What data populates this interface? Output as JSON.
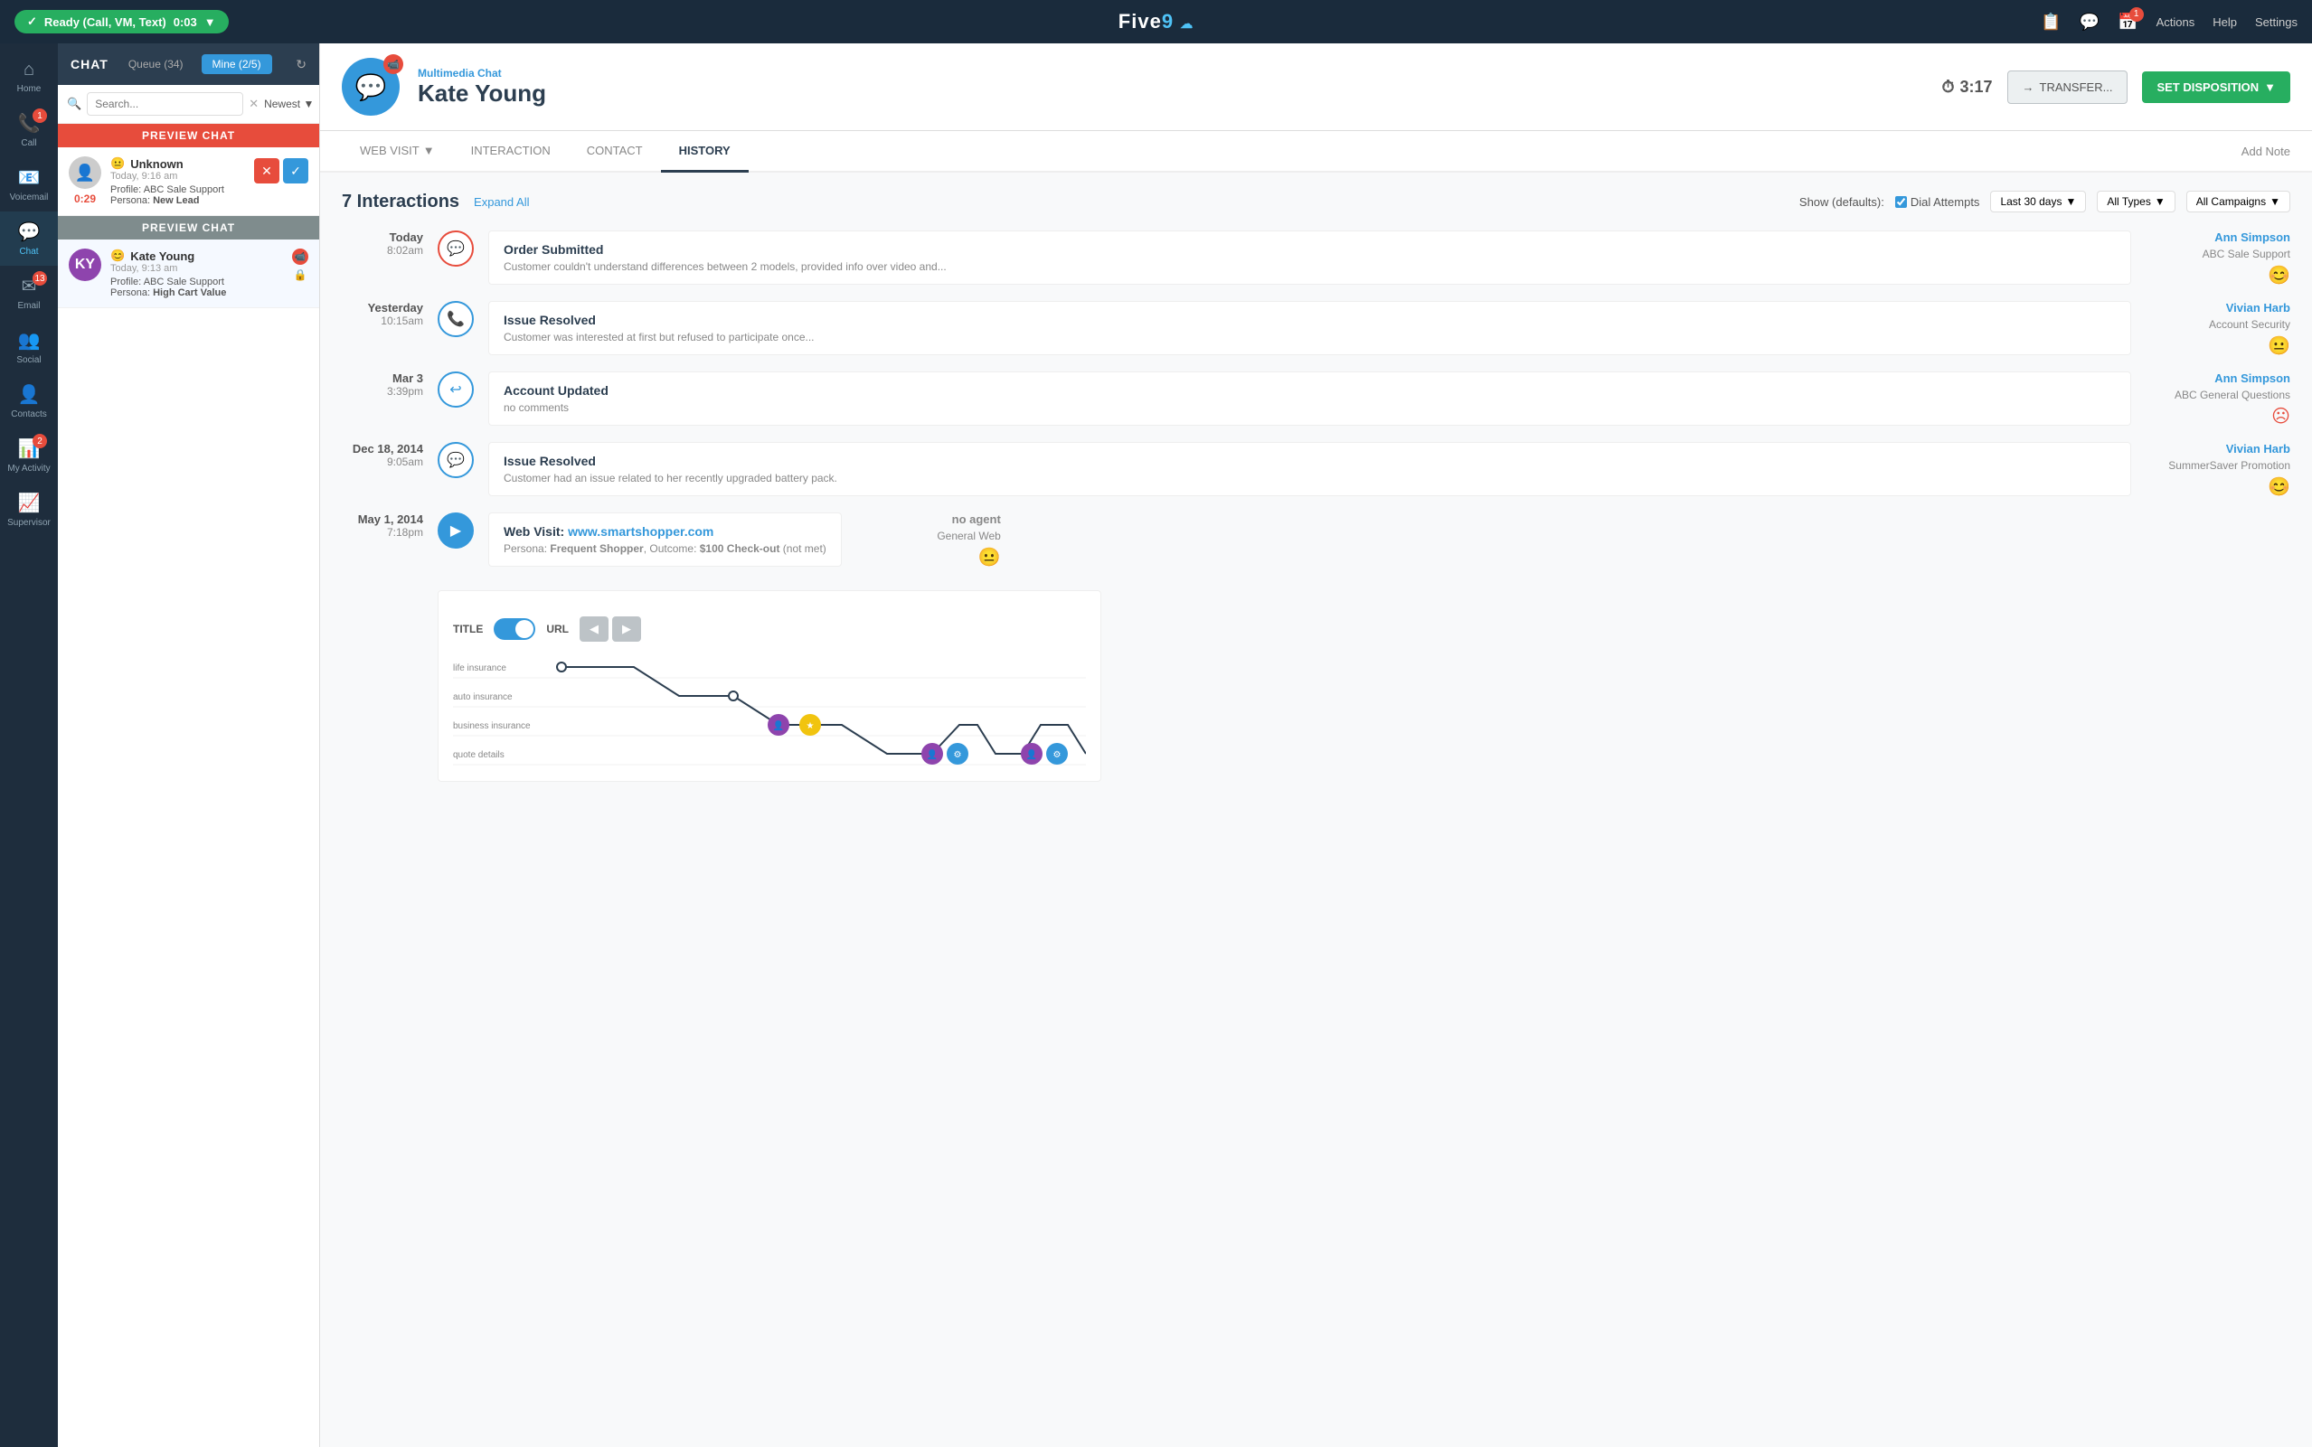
{
  "topbar": {
    "ready_label": "Ready (Call, VM, Text)",
    "timer": "0:03",
    "logo": "Five9",
    "actions_label": "Actions",
    "help_label": "Help",
    "settings_label": "Settings",
    "notification_count": "1"
  },
  "sidebar": {
    "items": [
      {
        "id": "home",
        "label": "Home",
        "icon": "⌂",
        "badge": null
      },
      {
        "id": "call",
        "label": "Call",
        "icon": "📞",
        "badge": "1"
      },
      {
        "id": "voicemail",
        "label": "Voicemail",
        "icon": "📧",
        "badge": null
      },
      {
        "id": "chat",
        "label": "Chat",
        "icon": "💬",
        "badge": null
      },
      {
        "id": "email",
        "label": "Email",
        "icon": "✉",
        "badge": "13"
      },
      {
        "id": "social",
        "label": "Social",
        "icon": "👥",
        "badge": null
      },
      {
        "id": "contacts",
        "label": "Contacts",
        "icon": "👤",
        "badge": null
      },
      {
        "id": "myactivity",
        "label": "My Activity",
        "icon": "📊",
        "badge": "2"
      },
      {
        "id": "supervisor",
        "label": "Supervisor",
        "icon": "📈",
        "badge": null
      }
    ]
  },
  "chat_panel": {
    "title": "CHAT",
    "queue_label": "Queue (34)",
    "mine_label": "Mine (2/5)",
    "search_placeholder": "Search...",
    "sort_label": "Newest",
    "preview_chat_label": "PREVIEW CHAT",
    "items": [
      {
        "name": "Unknown",
        "time": "Today, 9:16 am",
        "profile": "ABC Sale Support",
        "persona": "New Lead",
        "timer": "0:29",
        "has_actions": true,
        "avatar_icon": "👤"
      },
      {
        "name": "Kate Young",
        "time": "Today, 9:13 am",
        "profile": "ABC Sale Support",
        "persona": "High Cart Value",
        "timer": null,
        "has_actions": false,
        "has_lock": true,
        "avatar_url": null
      }
    ]
  },
  "contact_header": {
    "subtitle": "Multimedia Chat",
    "name": "Kate Young",
    "timer": "3:17",
    "transfer_label": "TRANSFER...",
    "disposition_label": "SET DISPOSITION"
  },
  "tabs": {
    "items": [
      {
        "id": "web-visit",
        "label": "WEB VISIT",
        "has_arrow": true
      },
      {
        "id": "interaction",
        "label": "INTERACTION"
      },
      {
        "id": "contact",
        "label": "CONTACT"
      },
      {
        "id": "history",
        "label": "HISTORY",
        "active": true
      }
    ],
    "add_note_label": "Add Note"
  },
  "history": {
    "count": "7 Interactions",
    "expand_all": "Expand All",
    "show_label": "Show (defaults):",
    "dial_attempts_label": "Dial Attempts",
    "last30_label": "Last 30 days",
    "all_types_label": "All Types",
    "all_campaigns_label": "All Campaigns",
    "interactions": [
      {
        "date": "Today",
        "time": "8:02am",
        "icon": "💬",
        "title": "Order Submitted",
        "desc": "Customer couldn't understand differences between 2 models, provided info over video and...",
        "agent": "Ann Simpson",
        "campaign": "ABC Sale Support",
        "sentiment": "happy",
        "icon_color": "#e74c3c"
      },
      {
        "date": "Yesterday",
        "time": "10:15am",
        "icon": "📞",
        "title": "Issue Resolved",
        "desc": "Customer was interested at first but refused to participate once...",
        "agent": "Vivian Harb",
        "campaign": "Account Security",
        "sentiment": "neutral",
        "icon_color": "#3498db"
      },
      {
        "date": "Mar 3",
        "time": "3:39pm",
        "icon": "↩",
        "title": "Account Updated",
        "desc": "no comments",
        "agent": "Ann Simpson",
        "campaign": "ABC General Questions",
        "sentiment": "sad",
        "icon_color": "#3498db"
      },
      {
        "date": "Dec 18, 2014",
        "time": "9:05am",
        "icon": "💬",
        "title": "Issue Resolved",
        "desc": "Customer had an issue related to her recently upgraded battery pack.",
        "agent": "Vivian Harb",
        "campaign": "SummerSaver Promotion",
        "sentiment": "happy",
        "icon_color": "#3498db"
      },
      {
        "date": "May 1, 2014",
        "time": "7:18pm",
        "icon": "▶",
        "title": "Web Visit:",
        "url": "www.smartshopper.com",
        "desc_parts": "Persona: <strong>Frequent Shopper</strong>, Outcome: <strong>$100 Check-out</strong> (not met)",
        "agent": "no agent",
        "campaign": "General Web",
        "sentiment": "neutral",
        "icon_color": "#3498db",
        "has_detail": true
      }
    ],
    "journey": {
      "toggle_title_label": "TITLE",
      "toggle_url_label": "URL",
      "labels": [
        "life insurance",
        "auto insurance",
        "business insurance",
        "quote details"
      ]
    }
  }
}
